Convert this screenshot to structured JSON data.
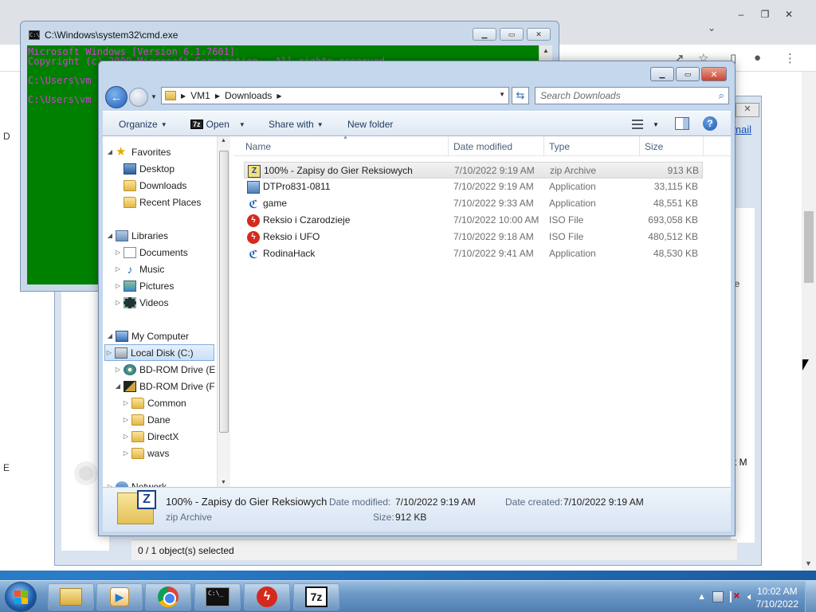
{
  "chrome": {
    "chevron": "⌄",
    "edge_text_right_1": "ie",
    "edge_text_right_2": "st M",
    "edge_text_left_1": "D",
    "edge_text_left_2": "E"
  },
  "midwin": {
    "email_link": "mail",
    "status_text": "0 / 1 object(s) selected"
  },
  "cmd": {
    "title": "C:\\Windows\\system32\\cmd.exe",
    "lines": [
      "Microsoft Windows [Version 6.1.7601]",
      "Copyright (c) 2009 Microsoft Corporation.  All rights reserved.",
      "",
      "C:\\Users\\vm",
      "",
      "C:\\Users\\vm"
    ],
    "text_color": "#d040d0",
    "bg_color": "#008000"
  },
  "explorer": {
    "address": [
      "VM1",
      "Downloads"
    ],
    "search_placeholder": "Search Downloads",
    "commands": {
      "organize": "Organize",
      "open": "Open",
      "share_with": "Share with",
      "new_folder": "New folder"
    },
    "columns": {
      "name": "Name",
      "date": "Date modified",
      "type": "Type",
      "size": "Size"
    },
    "tree": [
      {
        "label": "Favorites",
        "icon": "star-icon",
        "level": 0
      },
      {
        "label": "Desktop",
        "icon": "desktop-icon",
        "level": 1
      },
      {
        "label": "Downloads",
        "icon": "folder-icon",
        "level": 1
      },
      {
        "label": "Recent Places",
        "icon": "recent-places-icon",
        "level": 1
      },
      {
        "label": "Libraries",
        "icon": "library-icon",
        "level": 0
      },
      {
        "label": "Documents",
        "icon": "documents-icon",
        "level": 1
      },
      {
        "label": "Music",
        "icon": "music-icon",
        "level": 1
      },
      {
        "label": "Pictures",
        "icon": "pictures-icon",
        "level": 1
      },
      {
        "label": "Videos",
        "icon": "videos-icon",
        "level": 1
      },
      {
        "label": "My Computer",
        "icon": "computer-icon",
        "level": 0
      },
      {
        "label": "Local Disk (C:)",
        "icon": "disk-icon",
        "level": 1
      },
      {
        "label": "BD-ROM Drive (E",
        "icon": "bd-rom-icon",
        "level": 1
      },
      {
        "label": "BD-ROM Drive (F",
        "icon": "bd-rom-icon",
        "level": 1
      },
      {
        "label": "Common",
        "icon": "folder-icon",
        "level": 2
      },
      {
        "label": "Dane",
        "icon": "folder-icon",
        "level": 2
      },
      {
        "label": "DirectX",
        "icon": "folder-icon",
        "level": 2
      },
      {
        "label": "wavs",
        "icon": "folder-icon",
        "level": 2
      },
      {
        "label": "Network",
        "icon": "network-icon",
        "level": 0
      }
    ],
    "files": [
      {
        "name": "100% - Zapisy do Gier Reksiowych",
        "date": "7/10/2022 9:19 AM",
        "type": "zip Archive",
        "size": "913 KB",
        "icon": "zip-icon"
      },
      {
        "name": "DTPro831-0811",
        "date": "7/10/2022 9:19 AM",
        "type": "Application",
        "size": "33,115 KB",
        "icon": "app-icon"
      },
      {
        "name": "game",
        "date": "7/10/2022 9:33 AM",
        "type": "Application",
        "size": "48,551 KB",
        "icon": "game-icon"
      },
      {
        "name": "Reksio i Czarodzieje",
        "date": "7/10/2022 10:00 AM",
        "type": "ISO File",
        "size": "693,058 KB",
        "icon": "iso-icon"
      },
      {
        "name": "Reksio i UFO",
        "date": "7/10/2022 9:18 AM",
        "type": "ISO File",
        "size": "480,512 KB",
        "icon": "iso-icon"
      },
      {
        "name": "RodinaHack",
        "date": "7/10/2022 9:41 AM",
        "type": "Application",
        "size": "48,530 KB",
        "icon": "game-icon"
      }
    ],
    "details": {
      "name": "100% - Zapisy do Gier Reksiowych",
      "type": "zip Archive",
      "date_modified_label": "Date modified:",
      "date_modified": "7/10/2022 9:19 AM",
      "date_created_label": "Date created:",
      "date_created": "7/10/2022 9:19 AM",
      "size_label": "Size:",
      "size": "912 KB"
    }
  },
  "taskbar": {
    "time": "10:02 AM",
    "date": "7/10/2022",
    "apps": [
      "explorer",
      "media-player",
      "chrome",
      "cmd",
      "flash",
      "7zip"
    ]
  }
}
